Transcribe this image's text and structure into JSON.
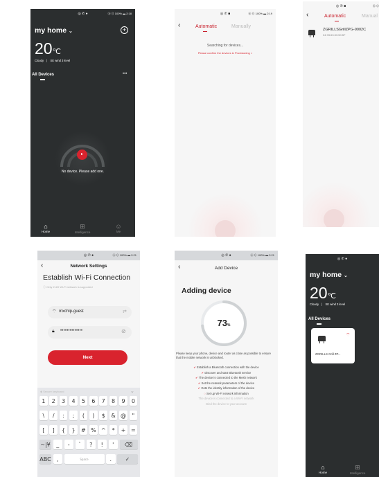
{
  "screen1": {
    "status": "◎ ✆ ●",
    "status_right": "ⓑ ⊙ 100% ▬ 2:18",
    "home_title": "my home",
    "temperature": "20",
    "temp_unit": "℃",
    "weather": "Cloudy",
    "wind": "SE wind 3 level",
    "section": "All Devices",
    "more": "•••",
    "empty_text": "No device. Please add one.",
    "nav": [
      {
        "label": "Home"
      },
      {
        "label": "Intelligence"
      },
      {
        "label": "Me"
      }
    ]
  },
  "screen2": {
    "status": "◎ ✆ ■",
    "status_right": "ⓑ ⊙ 100% ▬ 2:19",
    "tab_auto": "Automatic",
    "tab_manual": "Manually",
    "searching": "Searching for devices...",
    "confirm": "Please confirm the devices in Provisioning >"
  },
  "screen3": {
    "status": "◎ ✆ ■",
    "status_right": "ⓑ ⊙",
    "tab_auto": "Automatic",
    "tab_manual": "Manual",
    "device_name": "ZGRILLSGrillZPG-9002C",
    "device_mac": "04:78:63:33:50:5F"
  },
  "screen4": {
    "status": "◎ ✆ ●",
    "status_right": "ⓑ ⊙ 100% ▬ 2:21",
    "header": "Network Settings",
    "title": "Establish Wi-Fi Connection",
    "note": "Only 2.4G Wi-Fi network is supported",
    "ssid": "mxchip-guest",
    "password": "••••••••••••••",
    "next": "Next",
    "kb_hint": "Secure keyboard",
    "kb_rows": [
      [
        "1",
        "2",
        "3",
        "4",
        "5",
        "6",
        "7",
        "8",
        "9",
        "0"
      ],
      [
        "\\",
        "/",
        ":",
        ";",
        "(",
        ")",
        "$",
        "&",
        "@",
        "\""
      ],
      [
        "[",
        "]",
        "{",
        "}",
        "#",
        "%",
        "^",
        "*",
        "+",
        "="
      ]
    ],
    "kb_row4": [
      "~|¥",
      "_",
      "-",
      "`",
      "?",
      "!",
      "'"
    ],
    "kb_abc": "ABC",
    "kb_comma": ",",
    "kb_space": "Space",
    "kb_dot": ".",
    "kb_back": "⌫",
    "kb_done": "✓"
  },
  "screen5": {
    "status": "◎ ✆ ●",
    "status_right": "ⓑ ⊙ 100% ▬ 2:21",
    "header": "Add Device",
    "title": "Adding device",
    "progress": 73,
    "percent_sign": "%",
    "tip": "Please keep your phone, device and router as close as possible to ensure that the mobile network is unblocked.",
    "steps_done": [
      "Establish a Bluetooth connection with the device",
      "Discover and start Bluetooth service",
      "The device is connected to the Mesh network",
      "Set the network parameters of the device",
      "Gets the identity information of the device"
    ],
    "step_active": "Set up Wi-Fi network information",
    "steps_pending": [
      "The device is connected to a Wi-Fi network",
      "Bind the device to your account"
    ]
  },
  "screen6": {
    "status": "◎ ✆ ●",
    "home_title": "my home",
    "temperature": "20",
    "temp_unit": "℃",
    "weather": "Cloudy",
    "wind": "SE wind 3 level",
    "section": "All Devices",
    "device_name": "ZGRILLS Grill ZP...",
    "nav": [
      {
        "label": "Home"
      },
      {
        "label": "Intelligence"
      }
    ]
  },
  "colors": {
    "accent": "#d9232e",
    "dark_bg": "#2b2e2f"
  }
}
